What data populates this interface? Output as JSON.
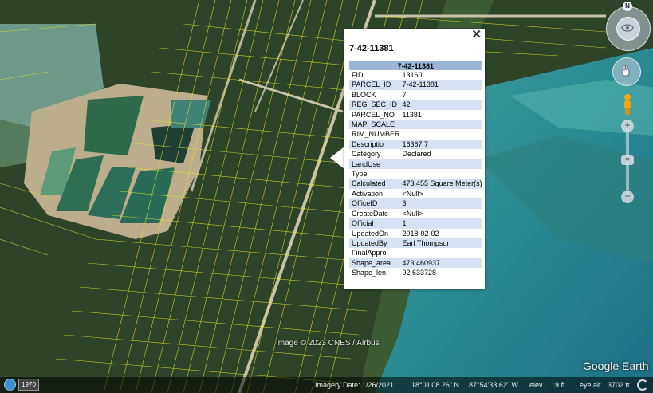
{
  "balloon": {
    "title": "7-42-11381",
    "close_glyph": "✕",
    "table_header": "7-42-11381",
    "rows": [
      {
        "key": "FID",
        "value": "13160"
      },
      {
        "key": "PARCEL_ID",
        "value": "7-42-11381"
      },
      {
        "key": "BLOCK",
        "value": "7"
      },
      {
        "key": "REG_SEC_ID",
        "value": "42"
      },
      {
        "key": "PARCEL_NO",
        "value": "11381"
      },
      {
        "key": "MAP_SCALE",
        "value": ""
      },
      {
        "key": "RIM_NUMBER",
        "value": ""
      },
      {
        "key": "Descriptio",
        "value": "16367 7"
      },
      {
        "key": "Category",
        "value": "Declared"
      },
      {
        "key": "LandUse",
        "value": ""
      },
      {
        "key": "Type",
        "value": ""
      },
      {
        "key": "Calculated",
        "value": "473.455 Square Meter(s)"
      },
      {
        "key": "Activation",
        "value": "<Null>"
      },
      {
        "key": "OfficeID",
        "value": "3"
      },
      {
        "key": "CreateDate",
        "value": "<Null>"
      },
      {
        "key": "Official",
        "value": "1"
      },
      {
        "key": "UpdatedOn",
        "value": "2018-02-02"
      },
      {
        "key": "UpdatedBy",
        "value": "Earl Thompson"
      },
      {
        "key": "FinalAppro",
        "value": ""
      },
      {
        "key": "Shape_area",
        "value": "473.460937"
      },
      {
        "key": "Shape_len",
        "value": "92.633728"
      }
    ]
  },
  "map": {
    "copyright": "Image © 2023 CNES / Airbus",
    "logo": "Google Earth",
    "north_label": "N",
    "parcel_line_color": "#e6e02a"
  },
  "controls": {
    "zoom_in": "+",
    "zoom_out": "−",
    "zoom_knob": "="
  },
  "statusbar": {
    "imagery_date": "Imagery Date: 1/26/2021",
    "latitude": "18°01'08.26\" N",
    "longitude": "87°54'33.62\" W",
    "elev_label": "elev",
    "elev_value": "19 ft",
    "eye_alt_label": "eye alt",
    "eye_alt_value": "3702 ft",
    "history_year": "1970"
  }
}
